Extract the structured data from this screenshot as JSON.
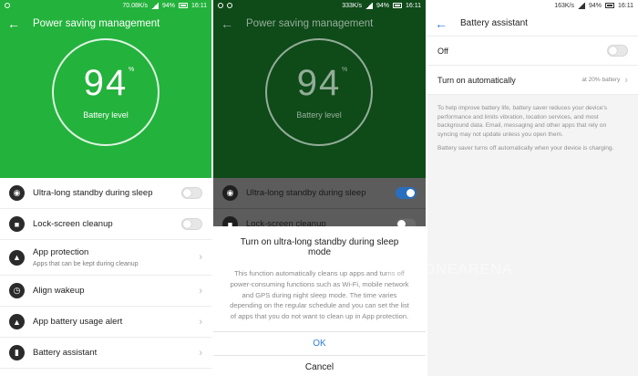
{
  "panel1": {
    "status": {
      "speed": "70.08K/s",
      "battery": "94%",
      "time": "16:11"
    },
    "title": "Power saving management",
    "battery_value": "94",
    "battery_unit": "%",
    "battery_label": "Battery level",
    "items": [
      {
        "title": "Ultra-long standby during sleep",
        "icon": "sleep-standby-icon",
        "control": "toggle-off"
      },
      {
        "title": "Lock-screen cleanup",
        "icon": "lock-cleanup-icon",
        "control": "toggle-off"
      },
      {
        "title": "App protection",
        "sub": "Apps that can be kept during cleanup",
        "icon": "shield-icon",
        "control": "chevron"
      },
      {
        "title": "Align wakeup",
        "icon": "alarm-icon",
        "control": "chevron"
      },
      {
        "title": "App battery usage alert",
        "icon": "bell-icon",
        "control": "chevron"
      },
      {
        "title": "Battery assistant",
        "icon": "battery-icon",
        "control": "chevron"
      }
    ]
  },
  "panel2": {
    "status": {
      "speed": "333K/s",
      "battery": "94%",
      "time": "16:11"
    },
    "title": "Power saving management",
    "battery_value": "94",
    "battery_unit": "%",
    "battery_label": "Battery level",
    "items": [
      {
        "title": "Ultra-long standby during sleep",
        "control": "toggle-on"
      },
      {
        "title": "Lock-screen cleanup",
        "control": "toggle-off"
      }
    ],
    "dialog": {
      "title": "Turn on ultra-long standby during sleep mode",
      "body": "This function automatically cleans up apps and turns off power-consuming functions such as Wi-Fi, mobile network and GPS during night sleep mode. The time varies depending on the regular schedule and you can set the list of apps that you do not want to clean up in App protection.",
      "ok": "OK",
      "cancel": "Cancel"
    }
  },
  "panel3": {
    "status": {
      "speed": "163K/s",
      "battery": "94%",
      "time": "16:11"
    },
    "title": "Battery assistant",
    "off_label": "Off",
    "auto_label": "Turn on automatically",
    "auto_value": "at 20% battery",
    "note1": "To help improve battery life, battery saver reduces your device's performance and limits vibration, location services, and most background data. Email, messaging and other apps that rely on syncing may not update unless you open them.",
    "note2": "Battery saver turns off automatically when your device is charging."
  },
  "watermark": "FONEARENA",
  "colors": {
    "green": "#23b23c",
    "accent": "#2f7fd8"
  }
}
